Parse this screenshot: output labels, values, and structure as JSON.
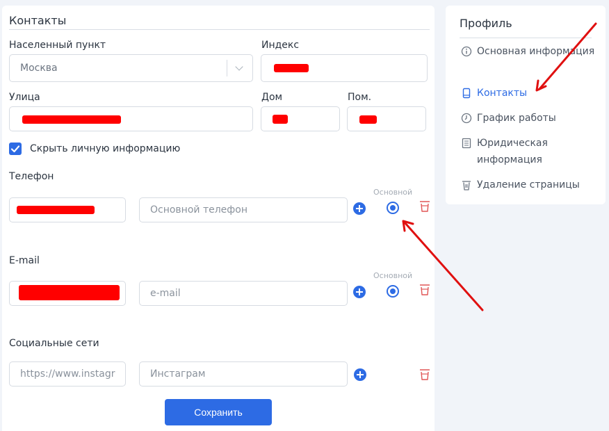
{
  "contacts": {
    "title": "Контакты",
    "city_label": "Населенный пункт",
    "city_value": "Москва",
    "index_label": "Индекс",
    "street_label": "Улица",
    "house_label": "Дом",
    "room_label": "Пом.",
    "hide_info_label": "Скрыть личную информацию",
    "hide_info_checked": true,
    "phone_label": "Телефон",
    "phone_placeholder": "Основной телефон",
    "primary_label": "Основной",
    "email_label": "E-mail",
    "email_placeholder": "e-mail",
    "social_label": "Социальные сети",
    "social_url_placeholder": "https://www.instagr",
    "social_name_placeholder": "Инстаграм",
    "save_label": "Сохранить"
  },
  "sidebar": {
    "title": "Профиль",
    "items": [
      {
        "label": "Основная информация",
        "icon": "info-icon",
        "active": false
      },
      {
        "label": "Контакты",
        "icon": "phone-icon",
        "active": true
      },
      {
        "label": "График работы",
        "icon": "clock-icon",
        "active": false
      },
      {
        "label": "Юридическая информация",
        "icon": "document-icon",
        "active": false
      },
      {
        "label": "Удаление страницы",
        "icon": "trash-icon",
        "active": false
      }
    ]
  },
  "colors": {
    "accent": "#2d6be4",
    "danger": "#e05555",
    "redaction": "#ff0000",
    "annotation_arrow": "#e01010"
  }
}
